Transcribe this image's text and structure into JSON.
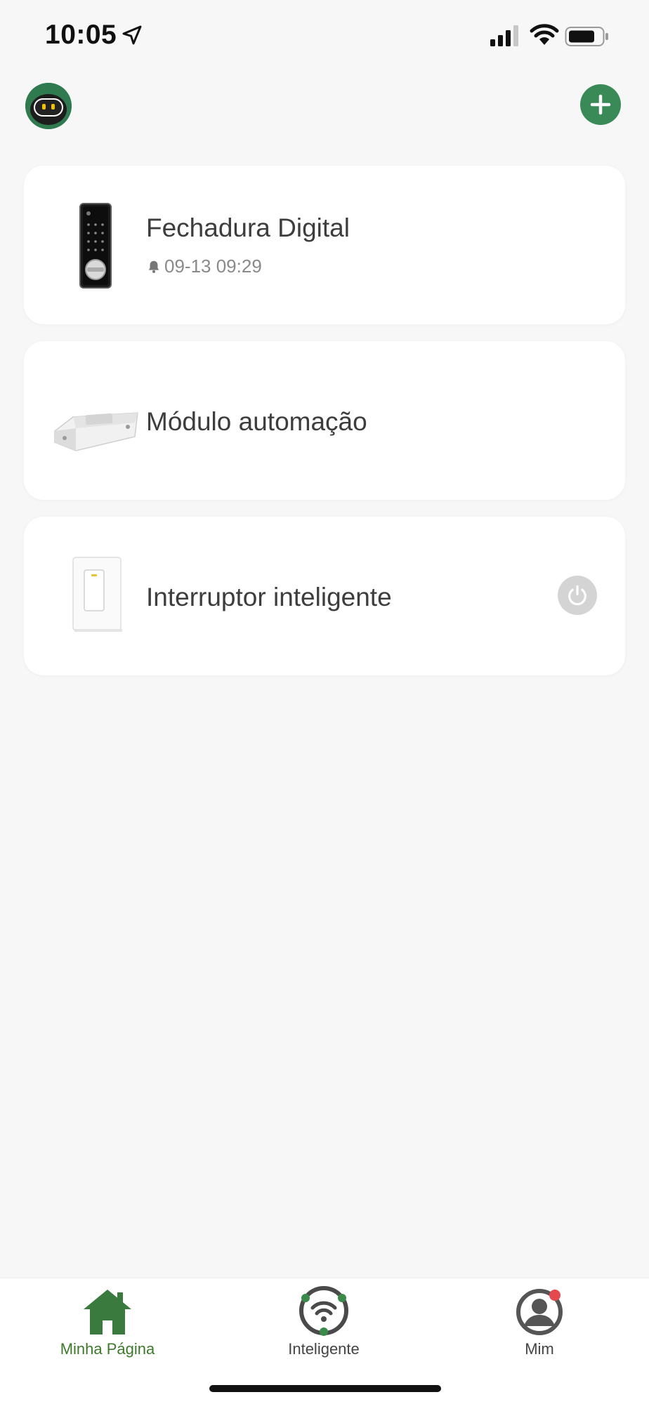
{
  "status_bar": {
    "time": "10:05",
    "icons": [
      "location-arrow-icon",
      "cellular-signal-icon",
      "wifi-icon",
      "battery-icon"
    ]
  },
  "header": {
    "avatar_icon": "robot-avatar-icon",
    "add_icon": "plus-icon"
  },
  "devices": [
    {
      "name": "Fechadura Digital",
      "subtitle": "09-13 09:29",
      "subtitle_icon": "bell-icon",
      "thumb": "smart-lock"
    },
    {
      "name": "Módulo automação",
      "thumb": "automation-module"
    },
    {
      "name": "Interruptor inteligente",
      "thumb": "wall-switch",
      "action_icon": "power-icon"
    }
  ],
  "bottom_nav": {
    "items": [
      {
        "label": "Minha Página",
        "icon": "home-icon",
        "active": true
      },
      {
        "label": "Inteligente",
        "icon": "smart-hub-icon",
        "active": false
      },
      {
        "label": "Mim",
        "icon": "user-icon",
        "badge": true,
        "active": false
      }
    ]
  },
  "colors": {
    "background": "#f7f7f7",
    "card": "#ffffff",
    "brand_green": "#3a8a58",
    "active_nav": "#3d7a2a",
    "badge_red": "#e5484d"
  }
}
